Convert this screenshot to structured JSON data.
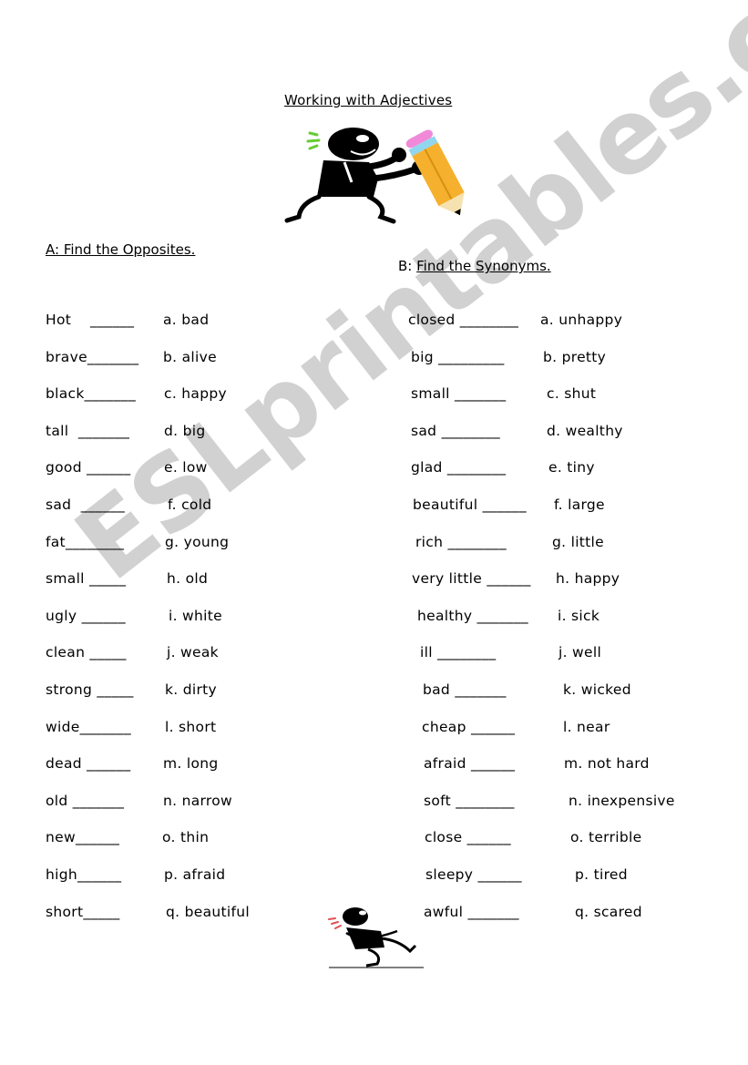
{
  "title": "Working with Adjectives",
  "watermark": "ESLprintables.com",
  "section_a": {
    "heading": "A: Find the Opposites.",
    "words": [
      "Hot",
      "brave",
      "black",
      "tall",
      "good",
      "sad",
      "fat",
      "small",
      "ugly",
      "clean",
      "strong",
      "wide",
      "dead",
      "old",
      "new",
      "high",
      "short"
    ],
    "blanks": [
      "______",
      "_______",
      "_______",
      "_______",
      "______",
      "______",
      "________",
      "_____",
      "______",
      "_____",
      "_____",
      "_______",
      "______",
      "_______",
      "______",
      "______",
      "_____"
    ],
    "options": [
      "a. bad",
      "b. alive",
      "c. happy",
      "d. big",
      "e. low",
      "f. cold",
      "g. young",
      "h. old",
      "i. white",
      "j. weak",
      "k. dirty",
      "l. short",
      "m. long",
      "n. narrow",
      "o. thin",
      "p. afraid",
      "q. beautiful"
    ]
  },
  "section_b": {
    "label": "B:",
    "heading": "Find the Synonyms.",
    "words": [
      "closed",
      "big",
      "small",
      "sad",
      "glad",
      "beautiful",
      "rich",
      "very little",
      "healthy",
      "ill",
      "bad",
      "cheap",
      "afraid",
      "soft",
      "close",
      "sleepy",
      "awful"
    ],
    "blanks": [
      "________",
      "_________",
      "_______",
      "________",
      "________",
      "______",
      "________",
      "______",
      "_______",
      "________",
      "_______",
      "______",
      "______",
      "________",
      "______",
      "______",
      "_______"
    ],
    "options": [
      "a. unhappy",
      "b. pretty",
      "c. shut",
      "d. wealthy",
      "e. tiny",
      "f. large",
      "g. little",
      "h. happy",
      "i. sick",
      "j. well",
      "k. wicked",
      "l. near",
      "m. not hard",
      "n. inexpensive",
      "o. terrible",
      "p. tired",
      "q. scared"
    ]
  },
  "colors": {
    "pencil_body": "#f5b02e",
    "eraser": "#f08ad8",
    "ferrule": "#8fd6ee",
    "accent_lines_green": "#66cc33",
    "accent_lines_red": "#e05050",
    "watermark": "#cfcfcf"
  }
}
